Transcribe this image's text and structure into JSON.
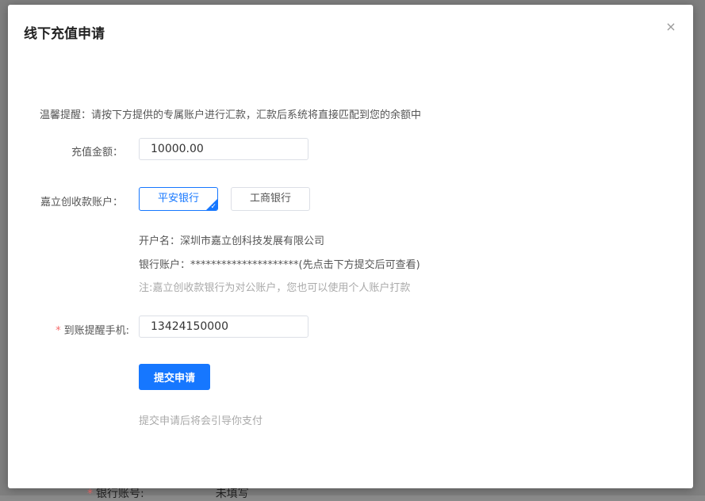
{
  "background_row": {
    "label": "银行账号:",
    "value": "未填写"
  },
  "dialog": {
    "title": "线下充值申请",
    "close_glyph": "×",
    "tip": "温馨提醒：请按下方提供的专属账户进行汇款，汇款后系统将直接匹配到您的余额中"
  },
  "form": {
    "amount": {
      "label": "充值金额：",
      "value": "10000.00"
    },
    "account": {
      "label": "嘉立创收款账户：",
      "options": [
        {
          "label": "平安银行",
          "selected": true
        },
        {
          "label": "工商银行",
          "selected": false
        }
      ]
    },
    "account_info": {
      "holder": "开户名：深圳市嘉立创科技发展有限公司",
      "number": "银行账户：*********************(先点击下方提交后可查看)",
      "note": "注:嘉立创收款银行为对公账户，您也可以使用个人账户打款"
    },
    "phone": {
      "required_mark": "*",
      "label": "到账提醒手机:",
      "value": "13424150000"
    },
    "submit_label": "提交申请",
    "footer_hint": "提交申请后将会引导你支付"
  },
  "colors": {
    "primary": "#1677ff",
    "required": "#f56c6c",
    "muted": "#aaaaaa"
  },
  "icons": {
    "close": "close-icon",
    "check": "check-icon"
  }
}
